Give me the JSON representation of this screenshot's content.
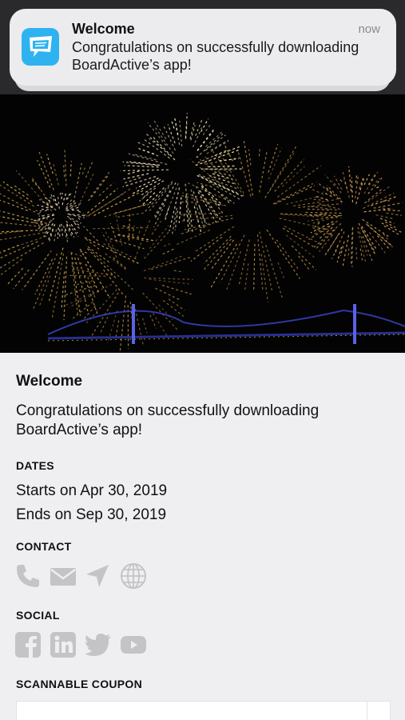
{
  "notification": {
    "title": "Welcome",
    "time": "now",
    "body": "Congratulations on successfully downloading BoardActive’s app!",
    "app_icon": "boardactive-app-icon"
  },
  "hero": {
    "image": "fireworks-over-bridge-photo"
  },
  "detail": {
    "title": "Welcome",
    "description": "Congratulations on successfully downloading BoardActive’s app!"
  },
  "dates": {
    "label": "DATES",
    "starts": "Starts on Apr 30, 2019",
    "ends": "Ends on Sep 30, 2019"
  },
  "contact": {
    "label": "CONTACT",
    "icons": [
      "phone-icon",
      "mail-icon",
      "location-arrow-icon",
      "globe-icon"
    ]
  },
  "social": {
    "label": "SOCIAL",
    "icons": [
      "facebook-icon",
      "linkedin-icon",
      "twitter-icon",
      "youtube-icon"
    ]
  },
  "coupon": {
    "label": "SCANNABLE COUPON"
  },
  "colors": {
    "background": "#efeff1",
    "icon_gray": "#c4c4c6",
    "app_icon_blue": "#2fb3f0"
  }
}
